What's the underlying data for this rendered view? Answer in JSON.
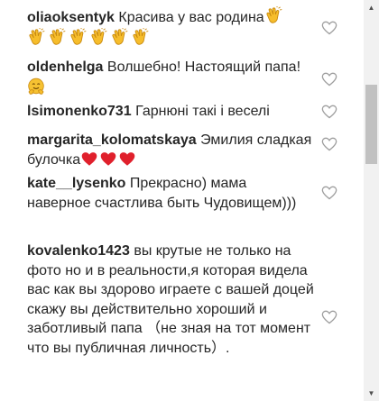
{
  "comments": [
    {
      "user": "oliaoksentyk",
      "text": "Красива у вас родина"
    },
    {
      "user": "oldenhelga",
      "text": "Волшебно! Настоящий папа!"
    },
    {
      "user": "lsimonenko731",
      "text": "Гарнюні такі і веселі"
    },
    {
      "user": "margarita_kolomatskaya",
      "text": "Эмилия сладкая булочка"
    },
    {
      "user": "kate__lysenko",
      "text": "Прекрасно) мама наверное счастлива быть Чудовищем)))"
    },
    {
      "user": "kovalenko1423",
      "text": "вы крутые не только на фото но и в реальности,я которая видела вас как вы здорово играете с вашей доцей скажу вы действительно хороший и заботливый папа （не зная на тот момент что вы публичная личность）."
    }
  ],
  "icons": {
    "like": "heart-outline-icon",
    "clap": "clapping-hands-emoji",
    "hug": "hugging-face-emoji",
    "red_heart": "red-heart-emoji"
  },
  "colors": {
    "text": "#262626",
    "heart_outline": "#9e9e9e",
    "red_heart": "#e0202c",
    "clap": "#f6bd2b"
  }
}
